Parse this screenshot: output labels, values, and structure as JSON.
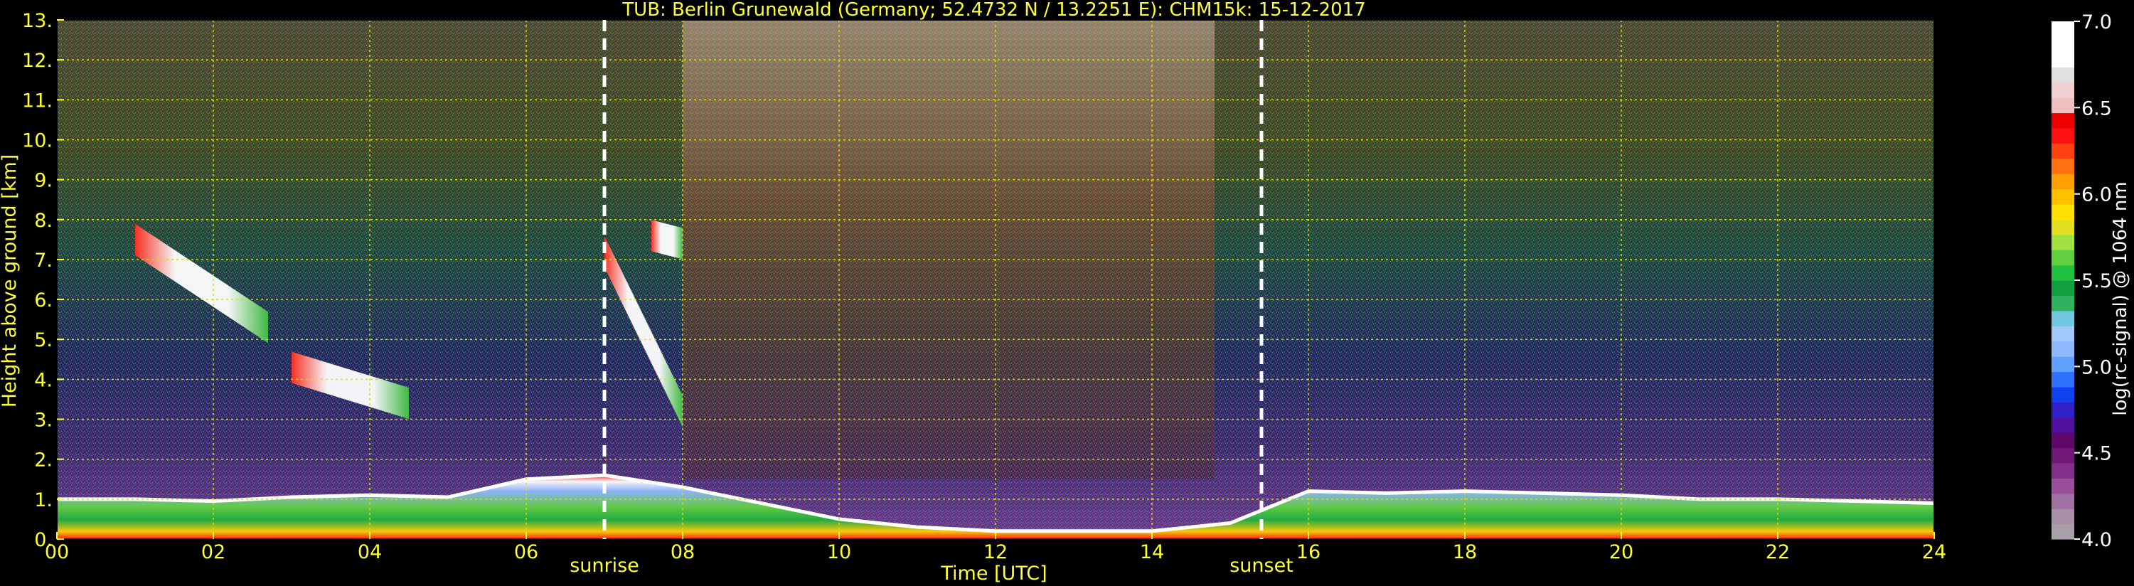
{
  "chart_data": {
    "type": "heatmap",
    "title": "TUB: Berlin Grunewald (Germany; 52.4732 N / 13.2251 E):    CHM15k: 15-12-2017",
    "xlabel": "Time [UTC]",
    "ylabel": "Height above ground [km]",
    "xlim": [
      0,
      24
    ],
    "ylim": [
      0,
      13
    ],
    "x_ticks": [
      0,
      2,
      4,
      6,
      8,
      10,
      12,
      14,
      16,
      18,
      20,
      22,
      24
    ],
    "x_tick_labels": [
      "00",
      "02",
      "04",
      "06",
      "08",
      "10",
      "12",
      "14",
      "16",
      "18",
      "20",
      "22",
      "24"
    ],
    "y_ticks": [
      0,
      1,
      2,
      3,
      4,
      5,
      6,
      7,
      8,
      9,
      10,
      11,
      12,
      13
    ],
    "y_tick_labels": [
      "0.",
      "1.",
      "2.",
      "3.",
      "4.",
      "5.",
      "6.",
      "7.",
      "8.",
      "9.",
      "10.",
      "11.",
      "12.",
      "13."
    ],
    "grid": true,
    "annotations": [
      {
        "label": "sunrise",
        "time": 7.0,
        "style": "dashed"
      },
      {
        "label": "sunset",
        "time": 15.4,
        "style": "dashed"
      }
    ],
    "colorbar": {
      "label": "log(rc-signal) @ 1064 nm",
      "range": [
        4.0,
        7.0
      ],
      "ticks": [
        4.0,
        4.5,
        5.0,
        5.5,
        6.0,
        6.5,
        7.0
      ],
      "tick_labels": [
        "4.0",
        "4.5",
        "5.0",
        "5.5",
        "6.0",
        "6.5",
        "7.0"
      ],
      "colors": [
        "#a8a0a8",
        "#a890a8",
        "#a070a0",
        "#985098",
        "#803088",
        "#701878",
        "#600868",
        "#5010a0",
        "#3020c8",
        "#1040f0",
        "#3070ff",
        "#60a0ff",
        "#90b8ff",
        "#a0c8f8",
        "#70c8e0",
        "#30b060",
        "#10a040",
        "#20c040",
        "#60d040",
        "#a0e040",
        "#e0e020",
        "#ffe000",
        "#ffc000",
        "#ffa000",
        "#ff7010",
        "#ff4010",
        "#ff1010",
        "#ee0000",
        "#f0c0c0",
        "#f0d0d0",
        "#e0e0e0",
        "#ffffff",
        "#ffffff",
        "#ffffff"
      ]
    },
    "features": [
      {
        "kind": "boundary_layer",
        "t": [
          0,
          1,
          2,
          3,
          4,
          5,
          6,
          7,
          8,
          9,
          10,
          11,
          12,
          13,
          14,
          15,
          16,
          17,
          18,
          19,
          20,
          21,
          22,
          23,
          24
        ],
        "top_km": [
          1.0,
          1.0,
          0.95,
          1.05,
          1.1,
          1.05,
          1.5,
          1.6,
          1.3,
          0.9,
          0.5,
          0.3,
          0.2,
          0.2,
          0.2,
          0.4,
          1.2,
          1.15,
          1.2,
          1.15,
          1.1,
          1.0,
          1.0,
          0.95,
          0.9
        ]
      },
      {
        "kind": "cloud",
        "t_start": 1.0,
        "t_end": 2.7,
        "h_start_km": 7.5,
        "h_end_km": 5.3
      },
      {
        "kind": "cloud",
        "t_start": 3.0,
        "t_end": 4.5,
        "h_start_km": 4.3,
        "h_end_km": 3.4
      },
      {
        "kind": "cloud",
        "t_start": 7.0,
        "t_end": 8.0,
        "h_start_km": 7.2,
        "h_end_km": 3.2
      },
      {
        "kind": "cloud",
        "t_start": 7.6,
        "t_end": 8.0,
        "h_start_km": 7.6,
        "h_end_km": 7.4
      }
    ]
  }
}
